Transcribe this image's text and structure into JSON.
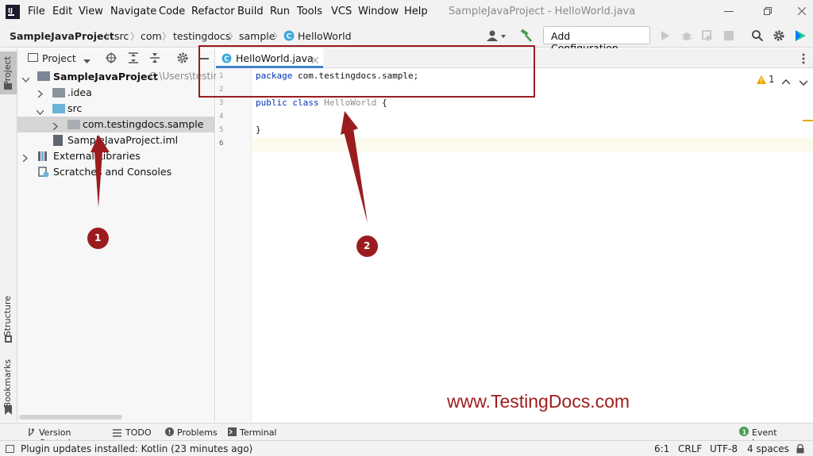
{
  "menu": [
    "File",
    "Edit",
    "View",
    "Navigate",
    "Code",
    "Refactor",
    "Build",
    "Run",
    "Tools",
    "VCS",
    "Window",
    "Help"
  ],
  "window_title": "SampleJavaProject - HelloWorld.java",
  "breadcrumbs": [
    "SampleJavaProject",
    "src",
    "com",
    "testingdocs",
    "sample",
    "HelloWorld"
  ],
  "run_config_label": "Add Configuration...",
  "left_strip": {
    "project": "Project",
    "structure": "Structure",
    "bookmarks": "Bookmarks"
  },
  "project_panel": {
    "title": "Project",
    "root_name": "SampleJavaProject",
    "root_path": "C:\\Users\\testing",
    "items": [
      ".idea",
      "src",
      "com.testingdocs.sample",
      "SampleJavaProject.iml",
      "External Libraries",
      "Scratches and Consoles"
    ]
  },
  "editor": {
    "tab_label": "HelloWorld.java",
    "line_numbers": [
      "1",
      "2",
      "3",
      "4",
      "5",
      "6"
    ],
    "line1_kw": "package",
    "line1_rest": " com.testingdocs.sample;",
    "line3_kw": "public class",
    "line3_cls": "HelloWorld",
    "line3_rest": " {",
    "line5": "}",
    "warning_count": "1"
  },
  "annotations": {
    "marker1": "1",
    "marker2": "2",
    "watermark": "www.TestingDocs.com"
  },
  "tool_windows": [
    "Version Control",
    "TODO",
    "Problems",
    "Terminal"
  ],
  "event_log": "Event Log",
  "status": {
    "message": "Plugin updates installed: Kotlin (23 minutes ago)",
    "position": "6:1",
    "line_sep": "CRLF",
    "encoding": "UTF-8",
    "indent": "4 spaces"
  },
  "colors": {
    "annotation_red": "#9b1c1f",
    "watermark_red": "#a01d1d",
    "java_class_icon": "#3fa9dc",
    "keyword_blue": "#0033b3"
  }
}
